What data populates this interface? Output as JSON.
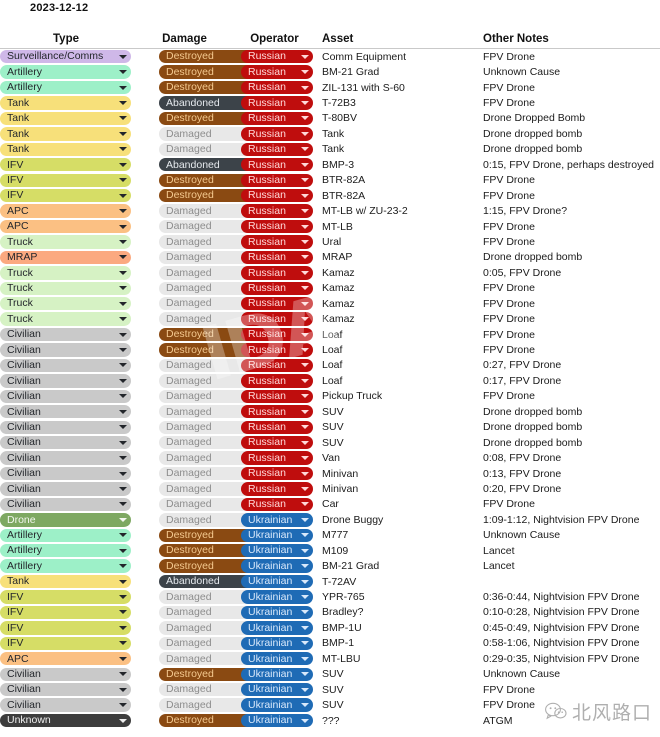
{
  "caption": {
    "date": "2023-12-12"
  },
  "table": {
    "headers": {
      "type": "Type",
      "damage": "Damage",
      "operator": "Operator",
      "asset": "Asset",
      "notes": "Other Notes"
    },
    "rows": [
      {
        "type": "Surveillance/Comms",
        "type_color": "#cfb8e8",
        "damage": "Destroyed",
        "damage_color": "#8a4a12",
        "operator": "Russian",
        "operator_color": "#bf0d0d",
        "asset": "Comm Equipment",
        "notes": "FPV Drone"
      },
      {
        "type": "Artillery",
        "type_color": "#9df0c8",
        "damage": "Destroyed",
        "damage_color": "#8a4a12",
        "operator": "Russian",
        "operator_color": "#bf0d0d",
        "asset": "BM-21 Grad",
        "notes": "Unknown Cause"
      },
      {
        "type": "Artillery",
        "type_color": "#9df0c8",
        "damage": "Destroyed",
        "damage_color": "#8a4a12",
        "operator": "Russian",
        "operator_color": "#bf0d0d",
        "asset": "ZIL-131 with S-60",
        "notes": "FPV Drone"
      },
      {
        "type": "Tank",
        "type_color": "#f7e07a",
        "damage": "Abandoned",
        "damage_color": "#3c4349",
        "operator": "Russian",
        "operator_color": "#bf0d0d",
        "asset": "T-72B3",
        "notes": "FPV Drone"
      },
      {
        "type": "Tank",
        "type_color": "#f7e07a",
        "damage": "Destroyed",
        "damage_color": "#8a4a12",
        "operator": "Russian",
        "operator_color": "#bf0d0d",
        "asset": "T-80BV",
        "notes": "Drone Dropped Bomb"
      },
      {
        "type": "Tank",
        "type_color": "#f7e07a",
        "damage": "Damaged",
        "damage_color": "#e8e8e8",
        "operator": "Russian",
        "operator_color": "#bf0d0d",
        "asset": "Tank",
        "notes": "Drone dropped bomb"
      },
      {
        "type": "Tank",
        "type_color": "#f7e07a",
        "damage": "Damaged",
        "damage_color": "#e8e8e8",
        "operator": "Russian",
        "operator_color": "#bf0d0d",
        "asset": "Tank",
        "notes": "Drone dropped bomb"
      },
      {
        "type": "IFV",
        "type_color": "#d6dd66",
        "damage": "Abandoned",
        "damage_color": "#3c4349",
        "operator": "Russian",
        "operator_color": "#bf0d0d",
        "asset": "BMP-3",
        "notes": "0:15, FPV Drone, perhaps destroyed"
      },
      {
        "type": "IFV",
        "type_color": "#d6dd66",
        "damage": "Destroyed",
        "damage_color": "#8a4a12",
        "operator": "Russian",
        "operator_color": "#bf0d0d",
        "asset": "BTR-82A",
        "notes": "FPV Drone"
      },
      {
        "type": "IFV",
        "type_color": "#d6dd66",
        "damage": "Destroyed",
        "damage_color": "#8a4a12",
        "operator": "Russian",
        "operator_color": "#bf0d0d",
        "asset": "BTR-82A",
        "notes": "FPV Drone"
      },
      {
        "type": "APC",
        "type_color": "#fbc083",
        "damage": "Damaged",
        "damage_color": "#e8e8e8",
        "operator": "Russian",
        "operator_color": "#bf0d0d",
        "asset": "MT-LB w/ ZU-23-2",
        "notes": "1:15, FPV Drone?"
      },
      {
        "type": "APC",
        "type_color": "#fbc083",
        "damage": "Damaged",
        "damage_color": "#e8e8e8",
        "operator": "Russian",
        "operator_color": "#bf0d0d",
        "asset": "MT-LB",
        "notes": "FPV Drone"
      },
      {
        "type": "Truck",
        "type_color": "#d6f2c4",
        "damage": "Damaged",
        "damage_color": "#e8e8e8",
        "operator": "Russian",
        "operator_color": "#bf0d0d",
        "asset": "Ural",
        "notes": "FPV Drone"
      },
      {
        "type": "MRAP",
        "type_color": "#fba980",
        "damage": "Damaged",
        "damage_color": "#e8e8e8",
        "operator": "Russian",
        "operator_color": "#bf0d0d",
        "asset": "MRAP",
        "notes": "Drone dropped bomb"
      },
      {
        "type": "Truck",
        "type_color": "#d6f2c4",
        "damage": "Damaged",
        "damage_color": "#e8e8e8",
        "operator": "Russian",
        "operator_color": "#bf0d0d",
        "asset": "Kamaz",
        "notes": "0:05, FPV Drone"
      },
      {
        "type": "Truck",
        "type_color": "#d6f2c4",
        "damage": "Damaged",
        "damage_color": "#e8e8e8",
        "operator": "Russian",
        "operator_color": "#bf0d0d",
        "asset": "Kamaz",
        "notes": "FPV Drone"
      },
      {
        "type": "Truck",
        "type_color": "#d6f2c4",
        "damage": "Damaged",
        "damage_color": "#e8e8e8",
        "operator": "Russian",
        "operator_color": "#bf0d0d",
        "asset": "Kamaz",
        "notes": "FPV Drone"
      },
      {
        "type": "Truck",
        "type_color": "#d6f2c4",
        "damage": "Damaged",
        "damage_color": "#e8e8e8",
        "operator": "Russian",
        "operator_color": "#bf0d0d",
        "asset": "Kamaz",
        "notes": "FPV Drone"
      },
      {
        "type": "Civilian",
        "type_color": "#c9c9c9",
        "damage": "Destroyed",
        "damage_color": "#8a4a12",
        "operator": "Russian",
        "operator_color": "#bf0d0d",
        "asset": "Loaf",
        "notes": "FPV Drone"
      },
      {
        "type": "Civilian",
        "type_color": "#c9c9c9",
        "damage": "Destroyed",
        "damage_color": "#8a4a12",
        "operator": "Russian",
        "operator_color": "#bf0d0d",
        "asset": "Loaf",
        "notes": "FPV Drone"
      },
      {
        "type": "Civilian",
        "type_color": "#c9c9c9",
        "damage": "Damaged",
        "damage_color": "#e8e8e8",
        "operator": "Russian",
        "operator_color": "#bf0d0d",
        "asset": "Loaf",
        "notes": "0:27, FPV Drone"
      },
      {
        "type": "Civilian",
        "type_color": "#c9c9c9",
        "damage": "Damaged",
        "damage_color": "#e8e8e8",
        "operator": "Russian",
        "operator_color": "#bf0d0d",
        "asset": "Loaf",
        "notes": "0:17, FPV Drone"
      },
      {
        "type": "Civilian",
        "type_color": "#c9c9c9",
        "damage": "Damaged",
        "damage_color": "#e8e8e8",
        "operator": "Russian",
        "operator_color": "#bf0d0d",
        "asset": "Pickup Truck",
        "notes": "FPV Drone"
      },
      {
        "type": "Civilian",
        "type_color": "#c9c9c9",
        "damage": "Damaged",
        "damage_color": "#e8e8e8",
        "operator": "Russian",
        "operator_color": "#bf0d0d",
        "asset": "SUV",
        "notes": "Drone dropped bomb"
      },
      {
        "type": "Civilian",
        "type_color": "#c9c9c9",
        "damage": "Damaged",
        "damage_color": "#e8e8e8",
        "operator": "Russian",
        "operator_color": "#bf0d0d",
        "asset": "SUV",
        "notes": "Drone dropped bomb"
      },
      {
        "type": "Civilian",
        "type_color": "#c9c9c9",
        "damage": "Damaged",
        "damage_color": "#e8e8e8",
        "operator": "Russian",
        "operator_color": "#bf0d0d",
        "asset": "SUV",
        "notes": "Drone dropped bomb"
      },
      {
        "type": "Civilian",
        "type_color": "#c9c9c9",
        "damage": "Damaged",
        "damage_color": "#e8e8e8",
        "operator": "Russian",
        "operator_color": "#bf0d0d",
        "asset": "Van",
        "notes": "0:08, FPV Drone"
      },
      {
        "type": "Civilian",
        "type_color": "#c9c9c9",
        "damage": "Damaged",
        "damage_color": "#e8e8e8",
        "operator": "Russian",
        "operator_color": "#bf0d0d",
        "asset": "Minivan",
        "notes": "0:13, FPV Drone"
      },
      {
        "type": "Civilian",
        "type_color": "#c9c9c9",
        "damage": "Damaged",
        "damage_color": "#e8e8e8",
        "operator": "Russian",
        "operator_color": "#bf0d0d",
        "asset": "Minivan",
        "notes": "0:20, FPV Drone"
      },
      {
        "type": "Civilian",
        "type_color": "#c9c9c9",
        "damage": "Damaged",
        "damage_color": "#e8e8e8",
        "operator": "Russian",
        "operator_color": "#bf0d0d",
        "asset": "Car",
        "notes": "FPV Drone"
      },
      {
        "type": "Drone",
        "type_color": "#7ea862",
        "damage": "Damaged",
        "damage_color": "#e8e8e8",
        "operator": "Ukrainian",
        "operator_color": "#1f6bb5",
        "asset": "Drone Buggy",
        "notes": "1:09-1:12, Nightvision FPV Drone"
      },
      {
        "type": "Artillery",
        "type_color": "#9df0c8",
        "damage": "Destroyed",
        "damage_color": "#8a4a12",
        "operator": "Ukrainian",
        "operator_color": "#1f6bb5",
        "asset": "M777",
        "notes": "Unknown Cause"
      },
      {
        "type": "Artillery",
        "type_color": "#9df0c8",
        "damage": "Destroyed",
        "damage_color": "#8a4a12",
        "operator": "Ukrainian",
        "operator_color": "#1f6bb5",
        "asset": "M109",
        "notes": "Lancet"
      },
      {
        "type": "Artillery",
        "type_color": "#9df0c8",
        "damage": "Destroyed",
        "damage_color": "#8a4a12",
        "operator": "Ukrainian",
        "operator_color": "#1f6bb5",
        "asset": "BM-21 Grad",
        "notes": "Lancet"
      },
      {
        "type": "Tank",
        "type_color": "#f7e07a",
        "damage": "Abandoned",
        "damage_color": "#3c4349",
        "operator": "Ukrainian",
        "operator_color": "#1f6bb5",
        "asset": "T-72AV",
        "notes": ""
      },
      {
        "type": "IFV",
        "type_color": "#d6dd66",
        "damage": "Damaged",
        "damage_color": "#e8e8e8",
        "operator": "Ukrainian",
        "operator_color": "#1f6bb5",
        "asset": "YPR-765",
        "notes": "0:36-0:44, Nightvision FPV Drone"
      },
      {
        "type": "IFV",
        "type_color": "#d6dd66",
        "damage": "Damaged",
        "damage_color": "#e8e8e8",
        "operator": "Ukrainian",
        "operator_color": "#1f6bb5",
        "asset": "Bradley?",
        "notes": "0:10-0:28, Nightvision FPV Drone"
      },
      {
        "type": "IFV",
        "type_color": "#d6dd66",
        "damage": "Damaged",
        "damage_color": "#e8e8e8",
        "operator": "Ukrainian",
        "operator_color": "#1f6bb5",
        "asset": "BMP-1U",
        "notes": "0:45-0:49, Nightvision FPV Drone"
      },
      {
        "type": "IFV",
        "type_color": "#d6dd66",
        "damage": "Damaged",
        "damage_color": "#e8e8e8",
        "operator": "Ukrainian",
        "operator_color": "#1f6bb5",
        "asset": "BMP-1",
        "notes": "0:58-1:06, Nightvision FPV Drone"
      },
      {
        "type": "APC",
        "type_color": "#fbc083",
        "damage": "Damaged",
        "damage_color": "#e8e8e8",
        "operator": "Ukrainian",
        "operator_color": "#1f6bb5",
        "asset": "MT-LBU",
        "notes": "0:29-0:35, Nightvision FPV Drone"
      },
      {
        "type": "Civilian",
        "type_color": "#c9c9c9",
        "damage": "Destroyed",
        "damage_color": "#8a4a12",
        "operator": "Ukrainian",
        "operator_color": "#1f6bb5",
        "asset": "SUV",
        "notes": "Unknown Cause"
      },
      {
        "type": "Civilian",
        "type_color": "#c9c9c9",
        "damage": "Damaged",
        "damage_color": "#e8e8e8",
        "operator": "Ukrainian",
        "operator_color": "#1f6bb5",
        "asset": "SUV",
        "notes": "FPV Drone"
      },
      {
        "type": "Civilian",
        "type_color": "#c9c9c9",
        "damage": "Damaged",
        "damage_color": "#e8e8e8",
        "operator": "Ukrainian",
        "operator_color": "#1f6bb5",
        "asset": "SUV",
        "notes": "FPV Drone"
      },
      {
        "type": "Unknown",
        "type_color": "#3d3d3d",
        "damage": "Destroyed",
        "damage_color": "#8a4a12",
        "operator": "Ukrainian",
        "operator_color": "#1f6bb5",
        "asset": "???",
        "notes": "ATGM"
      }
    ]
  },
  "watermarks": {
    "diagonal_line1": "IDA",
    "corner_text": "北风路口",
    "corner_icon": "wechat-icon"
  }
}
